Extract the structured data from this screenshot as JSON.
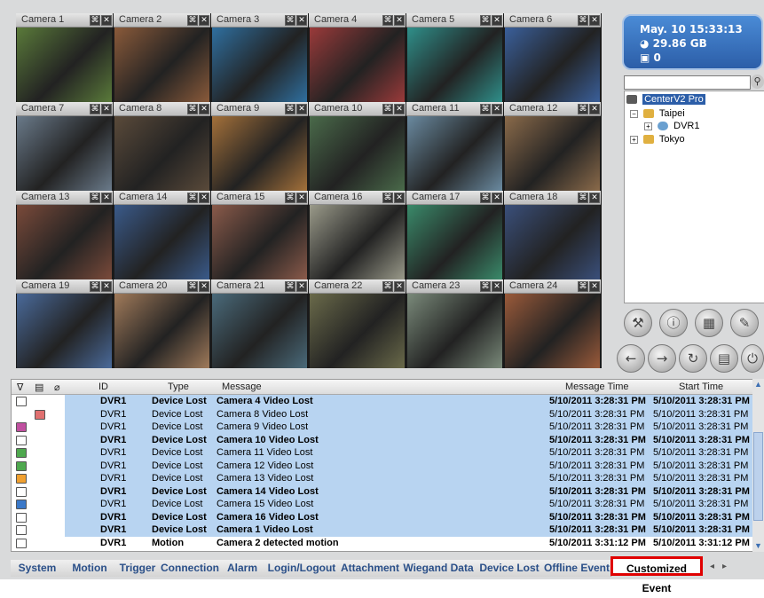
{
  "cameras": [
    {
      "name": "Camera 1",
      "img": "#5a7a3a"
    },
    {
      "name": "Camera 2",
      "img": "#8a5a3a"
    },
    {
      "name": "Camera 3",
      "img": "#2f6f9f"
    },
    {
      "name": "Camera 4",
      "img": "#9a3a3a"
    },
    {
      "name": "Camera 5",
      "img": "#2f8f8a"
    },
    {
      "name": "Camera 6",
      "img": "#3a5f9a"
    },
    {
      "name": "Camera 7",
      "img": "#6a7a8a"
    },
    {
      "name": "Camera 8",
      "img": "#5a4a3a"
    },
    {
      "name": "Camera 9",
      "img": "#a3703a"
    },
    {
      "name": "Camera 10",
      "img": "#4a6a4a"
    },
    {
      "name": "Camera 11",
      "img": "#6a8aa0"
    },
    {
      "name": "Camera 12",
      "img": "#8a6a4a"
    },
    {
      "name": "Camera 13",
      "img": "#7a4a3a"
    },
    {
      "name": "Camera 14",
      "img": "#3a5a8a"
    },
    {
      "name": "Camera 15",
      "img": "#8a5a4a"
    },
    {
      "name": "Camera 16",
      "img": "#9a9a8a"
    },
    {
      "name": "Camera 17",
      "img": "#3a8a6a"
    },
    {
      "name": "Camera 18",
      "img": "#3a4f7a"
    },
    {
      "name": "Camera 19",
      "img": "#4a6a9a"
    },
    {
      "name": "Camera 20",
      "img": "#a07a5a"
    },
    {
      "name": "Camera 21",
      "img": "#4a6a7a"
    },
    {
      "name": "Camera 22",
      "img": "#6a6a4a"
    },
    {
      "name": "Camera 23",
      "img": "#7a8a7a"
    },
    {
      "name": "Camera 24",
      "img": "#9a5a3a"
    }
  ],
  "status": {
    "datetime": "May. 10 15:33:13",
    "disk": "29.86 GB",
    "count": "0"
  },
  "tree": {
    "root": "CenterV2 Pro",
    "group1": "Taipei",
    "device1": "DVR1",
    "group2": "Tokyo"
  },
  "table": {
    "headers": {
      "id": "ID",
      "type": "Type",
      "message": "Message",
      "message_time": "Message Time",
      "start_time": "Start Time"
    },
    "rows": [
      {
        "icon": "mail",
        "id": "DVR1",
        "type": "Device Lost",
        "message": "Camera 4 Video Lost",
        "mtime": "5/10/2011 3:28:31 PM",
        "stime": "5/10/2011 3:28:31 PM",
        "bold": true,
        "blue": true
      },
      {
        "icon": "note",
        "id": "DVR1",
        "type": "Device Lost",
        "message": "Camera 8 Video Lost",
        "mtime": "5/10/2011 3:28:31 PM",
        "stime": "5/10/2011 3:28:31 PM",
        "bold": false,
        "blue": true
      },
      {
        "icon": "flag-pink",
        "id": "DVR1",
        "type": "Device Lost",
        "message": "Camera 9 Video Lost",
        "mtime": "5/10/2011 3:28:31 PM",
        "stime": "5/10/2011 3:28:31 PM",
        "bold": false,
        "blue": true
      },
      {
        "icon": "mail",
        "id": "DVR1",
        "type": "Device Lost",
        "message": "Camera 10 Video Lost",
        "mtime": "5/10/2011 3:28:31 PM",
        "stime": "5/10/2011 3:28:31 PM",
        "bold": true,
        "blue": true
      },
      {
        "icon": "flag-green",
        "id": "DVR1",
        "type": "Device Lost",
        "message": "Camera 11 Video Lost",
        "mtime": "5/10/2011 3:28:31 PM",
        "stime": "5/10/2011 3:28:31 PM",
        "bold": false,
        "blue": true
      },
      {
        "icon": "flag-green",
        "id": "DVR1",
        "type": "Device Lost",
        "message": "Camera 12 Video Lost",
        "mtime": "5/10/2011 3:28:31 PM",
        "stime": "5/10/2011 3:28:31 PM",
        "bold": false,
        "blue": true
      },
      {
        "icon": "flag-orange",
        "id": "DVR1",
        "type": "Device Lost",
        "message": "Camera 13 Video Lost",
        "mtime": "5/10/2011 3:28:31 PM",
        "stime": "5/10/2011 3:28:31 PM",
        "bold": false,
        "blue": true
      },
      {
        "icon": "mail",
        "id": "DVR1",
        "type": "Device Lost",
        "message": "Camera 14 Video Lost",
        "mtime": "5/10/2011 3:28:31 PM",
        "stime": "5/10/2011 3:28:31 PM",
        "bold": true,
        "blue": true
      },
      {
        "icon": "flag-blue",
        "id": "DVR1",
        "type": "Device Lost",
        "message": "Camera 15 Video Lost",
        "mtime": "5/10/2011 3:28:31 PM",
        "stime": "5/10/2011 3:28:31 PM",
        "bold": false,
        "blue": true
      },
      {
        "icon": "mail",
        "id": "DVR1",
        "type": "Device Lost",
        "message": "Camera 16 Video Lost",
        "mtime": "5/10/2011 3:28:31 PM",
        "stime": "5/10/2011 3:28:31 PM",
        "bold": true,
        "blue": true
      },
      {
        "icon": "mail",
        "id": "DVR1",
        "type": "Device Lost",
        "message": "Camera 1 Video Lost",
        "mtime": "5/10/2011 3:28:31 PM",
        "stime": "5/10/2011 3:28:31 PM",
        "bold": true,
        "blue": true
      },
      {
        "icon": "mail",
        "id": "DVR1",
        "type": "Motion",
        "message": "Camera 2 detected motion",
        "mtime": "5/10/2011 3:31:12 PM",
        "stime": "5/10/2011 3:31:12 PM",
        "bold": true,
        "blue": false
      }
    ]
  },
  "tabs": [
    "System",
    "Motion",
    "Trigger",
    "Connection",
    "Alarm",
    "Login/Logout",
    "Attachment",
    "Wiegand Data",
    "Device Lost",
    "Offline Event",
    "Customized Event"
  ],
  "active_tab": "Customized Event",
  "colors": {
    "flag-pink": "#c050a0",
    "flag-green": "#4ea84e",
    "flag-orange": "#f0a030",
    "flag-blue": "#3a78c8",
    "note": "#e07070",
    "mail": "#ffffff"
  }
}
